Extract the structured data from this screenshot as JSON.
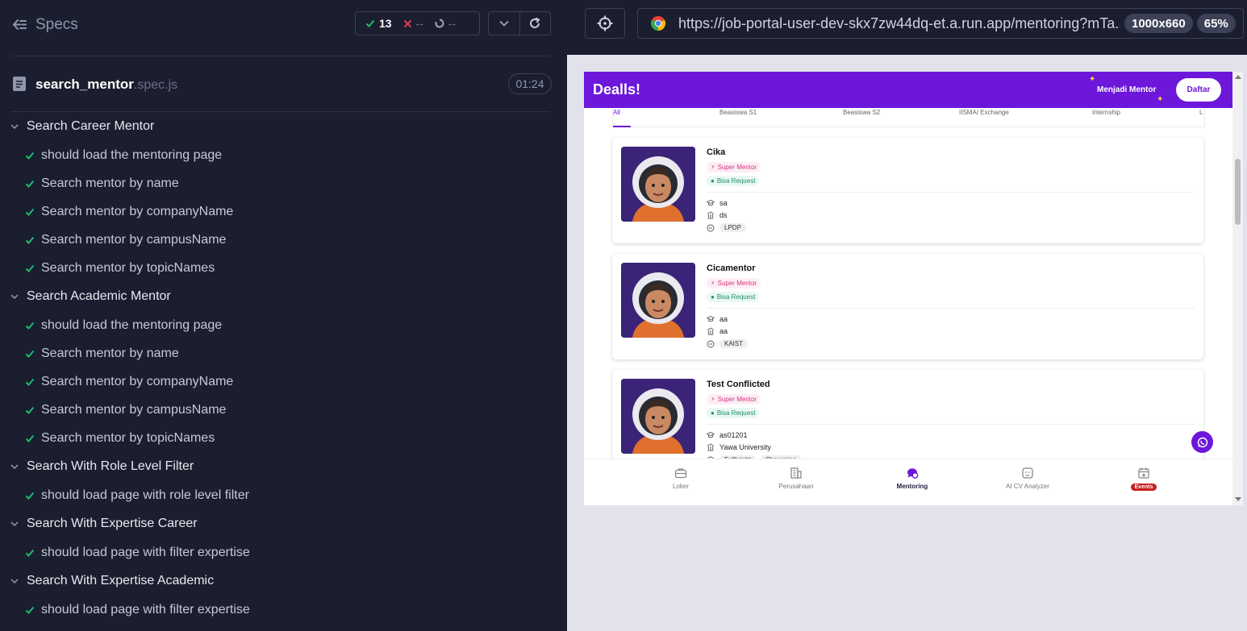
{
  "reporter": {
    "specs_label": "Specs",
    "stats": {
      "passed": "13",
      "failed": "--",
      "pending": "--"
    },
    "file": {
      "name": "search_mentor",
      "ext": ".spec.js",
      "duration": "01:24"
    },
    "suites": [
      {
        "title": "Search Career Mentor",
        "tests": [
          "should load the mentoring page",
          "Search mentor by name",
          "Search mentor by companyName",
          "Search mentor by campusName",
          "Search mentor by topicNames"
        ]
      },
      {
        "title": "Search Academic Mentor",
        "tests": [
          "should load the mentoring page",
          "Search mentor by name",
          "Search mentor by companyName",
          "Search mentor by campusName",
          "Search mentor by topicNames"
        ]
      },
      {
        "title": "Search With Role Level Filter",
        "tests": [
          "should load page with role level filter"
        ]
      },
      {
        "title": "Search With Expertise Career",
        "tests": [
          "should load page with filter expertise"
        ]
      },
      {
        "title": "Search With Expertise Academic",
        "tests": [
          "should load page with filter expertise"
        ]
      }
    ]
  },
  "browser": {
    "url": "https://job-portal-user-dev-skx7zw44dq-et.a.run.app/mentoring?mTa...",
    "viewport_size": "1000x660",
    "zoom": "65%"
  },
  "app": {
    "brand": "Dealls!",
    "become_mentor": "Menjadi Mentor",
    "register": "Daftar",
    "tabs": [
      "All",
      "Beasiswa S1",
      "Beasiswa S2",
      "IISMA/ Exchange",
      "Internship",
      "L"
    ],
    "super_badge": "Super Mentor",
    "request_badge": "Bisa Request",
    "mentors": [
      {
        "name": "Cika",
        "education": "sa",
        "institution": "ds",
        "tags": [
          "LPDP"
        ]
      },
      {
        "name": "Cicamentor",
        "education": "aa",
        "institution": "aa",
        "tags": [
          "KAIST"
        ]
      },
      {
        "name": "Test Conflicted",
        "education": "as01201",
        "institution": "Yawa University",
        "tags": [
          "Fullbright",
          "Chevening"
        ]
      }
    ],
    "bottom_nav": [
      "Loker",
      "Perusahaan",
      "Mentoring",
      "AI CV Analyzer",
      "Events"
    ],
    "colors": {
      "brand": "#6c17da",
      "pass": "#1fbb6a",
      "fail": "#e03b5c"
    }
  }
}
